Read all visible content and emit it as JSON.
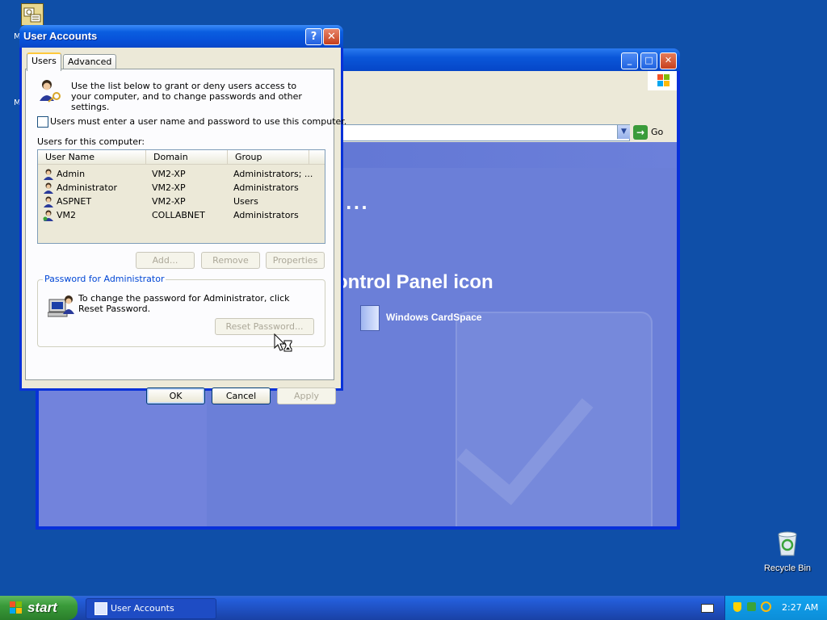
{
  "desktop": {
    "label_fragments": [
      "M",
      "M"
    ],
    "recycle_bin_label": "Recycle Bin"
  },
  "background_window": {
    "go_label": "Go",
    "ellipsis": "...",
    "heading_fragment": "ontrol Panel icon",
    "cardspace_label": "Windows CardSpace"
  },
  "dialog": {
    "title": "User Accounts",
    "help_glyph": "?",
    "close_glyph": "✕",
    "tabs": [
      {
        "label": "Users",
        "active": true
      },
      {
        "label": "Advanced",
        "active": false
      }
    ],
    "intro": "Use the list below to grant or deny users access to your computer, and to change passwords and other settings.",
    "require_password_label": "Users must enter a user name and password to use this computer.",
    "require_password_checked": false,
    "users_label": "Users for this computer:",
    "columns": [
      "User Name",
      "Domain",
      "Group"
    ],
    "users": [
      {
        "name": "Admin",
        "domain": "VM2-XP",
        "group": "Administrators; ..."
      },
      {
        "name": "Administrator",
        "domain": "VM2-XP",
        "group": "Administrators"
      },
      {
        "name": "ASPNET",
        "domain": "VM2-XP",
        "group": "Users"
      },
      {
        "name": "VM2",
        "domain": "COLLABNET",
        "group": "Administrators"
      }
    ],
    "buttons": {
      "add": "Add...",
      "remove": "Remove",
      "properties": "Properties"
    },
    "password_group": {
      "legend": "Password for Administrator",
      "text": "To change the password for Administrator, click Reset Password.",
      "reset_button": "Reset Password..."
    },
    "footer": {
      "ok": "OK",
      "cancel": "Cancel",
      "apply": "Apply"
    }
  },
  "taskbar": {
    "start_label": "start",
    "task_label": "User Accounts",
    "clock": "2:27 AM"
  },
  "colors": {
    "desktop": "#0f4fa8",
    "titlebar": "#0a5ee0",
    "dialog_face": "#ece9d8",
    "start_green": "#3a9b3a",
    "link_blue": "#0046d5"
  }
}
